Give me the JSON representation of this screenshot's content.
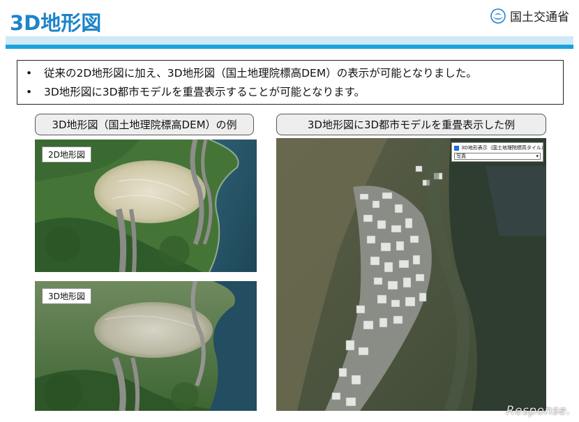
{
  "header": {
    "title": "3D地形図",
    "ministry": "国土交通省"
  },
  "bullets": [
    "従来の2D地形図に加え、3D地形図（国土地理院標高DEM）の表示が可能となりました。",
    "3D地形図に3D都市モデルを重畳表示することが可能となります。"
  ],
  "bullet_marker": "•",
  "left_panel": {
    "caption": "3D地形図（国土地理院標高DEM）の例",
    "images": [
      {
        "label": "2D地形図"
      },
      {
        "label": "3D地形図"
      }
    ]
  },
  "right_panel": {
    "caption": "3D地形図に3D都市モデルを重畳表示した例",
    "control": {
      "checkbox_label": "3D地形表示（国土地理院標高タイル）",
      "checked": true,
      "select_value": "写真"
    }
  },
  "watermark": "Response."
}
